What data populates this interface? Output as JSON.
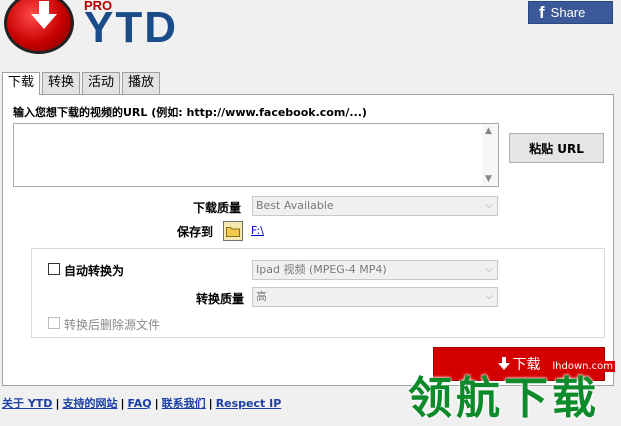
{
  "header": {
    "logo_pro": "PRO",
    "logo_ytd": "YTD",
    "share_icon_letter": "f",
    "share_label": "Share"
  },
  "tabs": [
    {
      "label": "下载",
      "active": true
    },
    {
      "label": "转换",
      "active": false
    },
    {
      "label": "活动",
      "active": false
    },
    {
      "label": "播放",
      "active": false
    }
  ],
  "download_tab": {
    "url_label": "输入您想下载的视频的URL (例如: http://www.facebook.com/...)",
    "url_value": "",
    "paste_button": "粘贴 URL",
    "quality_label": "下载质量",
    "quality_value": "Best Available",
    "save_to_label": "保存到",
    "save_path": "F:\\",
    "auto_convert_label": "自动转换为",
    "convert_format_value": "Ipad 视频 (MPEG-4 MP4)",
    "convert_quality_label": "转换质量",
    "convert_quality_value": "高",
    "delete_after_label": "转换后删除源文件",
    "download_button": "下载"
  },
  "footer": {
    "links": [
      "关于 YTD",
      "支持的网站",
      "FAQ",
      "联系我们",
      "Respect IP"
    ],
    "separator": "|"
  },
  "watermark": {
    "text": "领航下载",
    "url": "lhdown.com"
  },
  "colors": {
    "logo_red": "#c80000",
    "logo_blue": "#1a4c8a",
    "facebook_blue": "#3b5998",
    "download_red": "#d40000",
    "link_blue": "#1a3fa6",
    "watermark_green": "#0d8a2a"
  },
  "icons": {
    "logo": "download-arrow-icon",
    "share": "facebook-icon",
    "folder": "folder-icon",
    "download": "down-arrow-icon",
    "dropdown": "chevron-down-icon",
    "scroll_up": "chevron-up-icon",
    "scroll_down": "chevron-down-icon"
  }
}
